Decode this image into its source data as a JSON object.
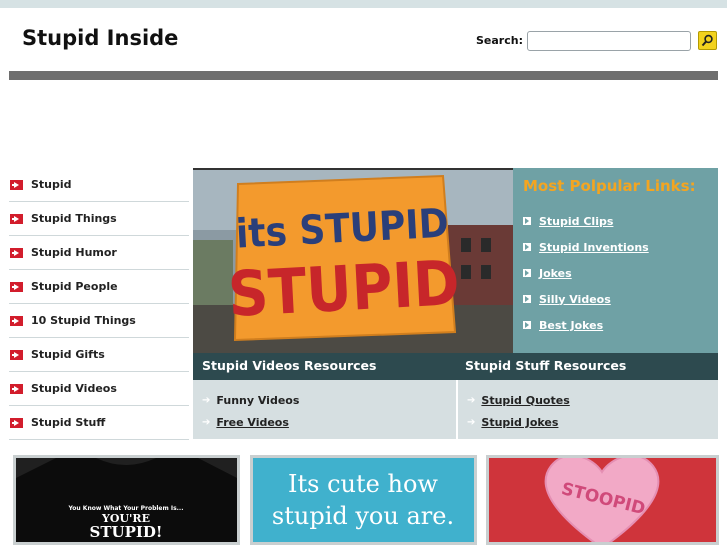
{
  "header": {
    "site_title": "Stupid Inside",
    "search_label": "Search:",
    "search_value": "",
    "search_icon": "magnifier-icon"
  },
  "sidebar": {
    "items": [
      {
        "label": "Stupid"
      },
      {
        "label": "Stupid Things"
      },
      {
        "label": "Stupid Humor"
      },
      {
        "label": "Stupid People"
      },
      {
        "label": "10 Stupid Things"
      },
      {
        "label": "Stupid Gifts"
      },
      {
        "label": "Stupid Videos"
      },
      {
        "label": "Stupid Stuff"
      }
    ]
  },
  "hero": {
    "sign_line1": "its STUPID",
    "sign_line2": "STUPID"
  },
  "popular": {
    "title": "Most Polpular Links:",
    "links": [
      {
        "label": "Stupid Clips"
      },
      {
        "label": "Stupid Inventions"
      },
      {
        "label": "Jokes"
      },
      {
        "label": "Silly Videos"
      },
      {
        "label": "Best Jokes"
      }
    ]
  },
  "videos_resources": {
    "title": "Stupid Videos Resources",
    "items": [
      {
        "label": "Funny Videos"
      },
      {
        "label": "Free Videos"
      }
    ]
  },
  "stuff_resources": {
    "title": "Stupid Stuff Resources",
    "items": [
      {
        "label": "Stupid Quotes"
      },
      {
        "label": "Stupid Jokes"
      }
    ]
  },
  "thumbnails": {
    "shirt_small": "You Know What Your Problem Is...",
    "shirt_big1": "YOU'RE",
    "shirt_big2": "STUPID!",
    "cute_line1": "Its cute how",
    "cute_line2": "stupid you are.",
    "candy_text": "STOOPID"
  },
  "colors": {
    "accent_orange": "#f3a521",
    "panel_teal": "#6fa1a5",
    "header_dark": "#2d4a4f",
    "arrow_red": "#d21d2c"
  }
}
